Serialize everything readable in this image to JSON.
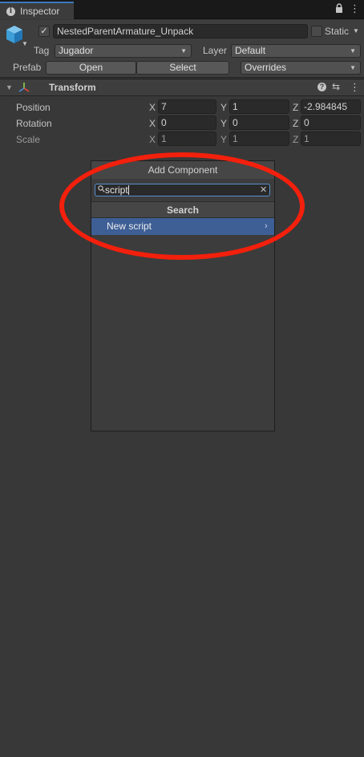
{
  "tab": {
    "title": "Inspector",
    "info_icon": "info-icon",
    "lock_icon": "lock-icon",
    "menu_icon": "kebab-menu-icon"
  },
  "object": {
    "active": true,
    "name": "NestedParentArmature_Unpack",
    "static_label": "Static",
    "static_checked": false,
    "icon": "prefab-cube-icon",
    "icon_color": "#3d9ed8"
  },
  "tag": {
    "label": "Tag",
    "value": "Jugador"
  },
  "layer": {
    "label": "Layer",
    "value": "Default"
  },
  "prefab": {
    "label": "Prefab",
    "open": "Open",
    "select": "Select",
    "overrides": "Overrides"
  },
  "transform": {
    "title": "Transform",
    "rows": [
      {
        "label": "Position",
        "x": "7",
        "y": "1",
        "z": "-2.984845"
      },
      {
        "label": "Rotation",
        "x": "0",
        "y": "0",
        "z": "0"
      },
      {
        "label": "Scale",
        "x": "1",
        "y": "1",
        "z": "1"
      }
    ],
    "axis": {
      "x": "X",
      "y": "Y",
      "z": "Z"
    }
  },
  "add_component": {
    "title": "Add Component",
    "search_value": "script",
    "section": "Search",
    "results": [
      {
        "label": "New script"
      }
    ]
  },
  "colors": {
    "accent": "#3a79bb",
    "selection": "#3e5f96",
    "annotation": "#f2200c",
    "background": "#383838"
  }
}
